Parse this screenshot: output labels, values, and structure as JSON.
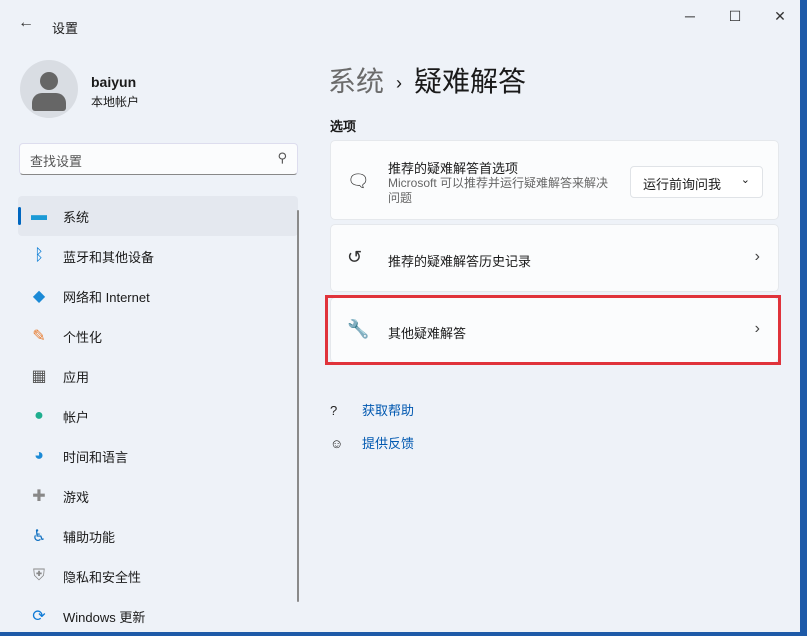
{
  "window": {
    "title": "设置",
    "back_icon": "back-arrow-icon",
    "controls": [
      "─",
      "☐",
      "✕"
    ]
  },
  "user": {
    "name": "baiyun",
    "type": "本地帐户"
  },
  "search": {
    "placeholder": "查找设置"
  },
  "nav": [
    {
      "label": "系统",
      "icon": "▬",
      "color": "#1b9ad6"
    },
    {
      "label": "蓝牙和其他设备",
      "icon": "ᛒ",
      "color": "#0078d4"
    },
    {
      "label": "网络和 Internet",
      "icon": "◆",
      "color": "#1b8ad6"
    },
    {
      "label": "个性化",
      "icon": "✎",
      "color": "#e87a2c"
    },
    {
      "label": "应用",
      "icon": "▦",
      "color": "#555"
    },
    {
      "label": "帐户",
      "icon": "●",
      "color": "#1fae8f"
    },
    {
      "label": "时间和语言",
      "icon": "◕",
      "color": "#1b8ad6"
    },
    {
      "label": "游戏",
      "icon": "✚",
      "color": "#888"
    },
    {
      "label": "辅助功能",
      "icon": "♿",
      "color": "#0e6fc0"
    },
    {
      "label": "隐私和安全性",
      "icon": "⛨",
      "color": "#888"
    },
    {
      "label": "Windows 更新",
      "icon": "⟳",
      "color": "#0e7ad6"
    }
  ],
  "breadcrumb": {
    "parent": "系统",
    "sep": "›",
    "current": "疑难解答"
  },
  "section": "选项",
  "cards": {
    "pref": {
      "title": "推荐的疑难解答首选项",
      "desc": "Microsoft 可以推荐并运行疑难解答来解决问题",
      "dropdown": "运行前询问我"
    },
    "history": {
      "title": "推荐的疑难解答历史记录"
    },
    "other": {
      "title": "其他疑难解答"
    }
  },
  "links": {
    "help": "获取帮助",
    "feedback": "提供反馈"
  },
  "highlight_color": "#e0333b"
}
